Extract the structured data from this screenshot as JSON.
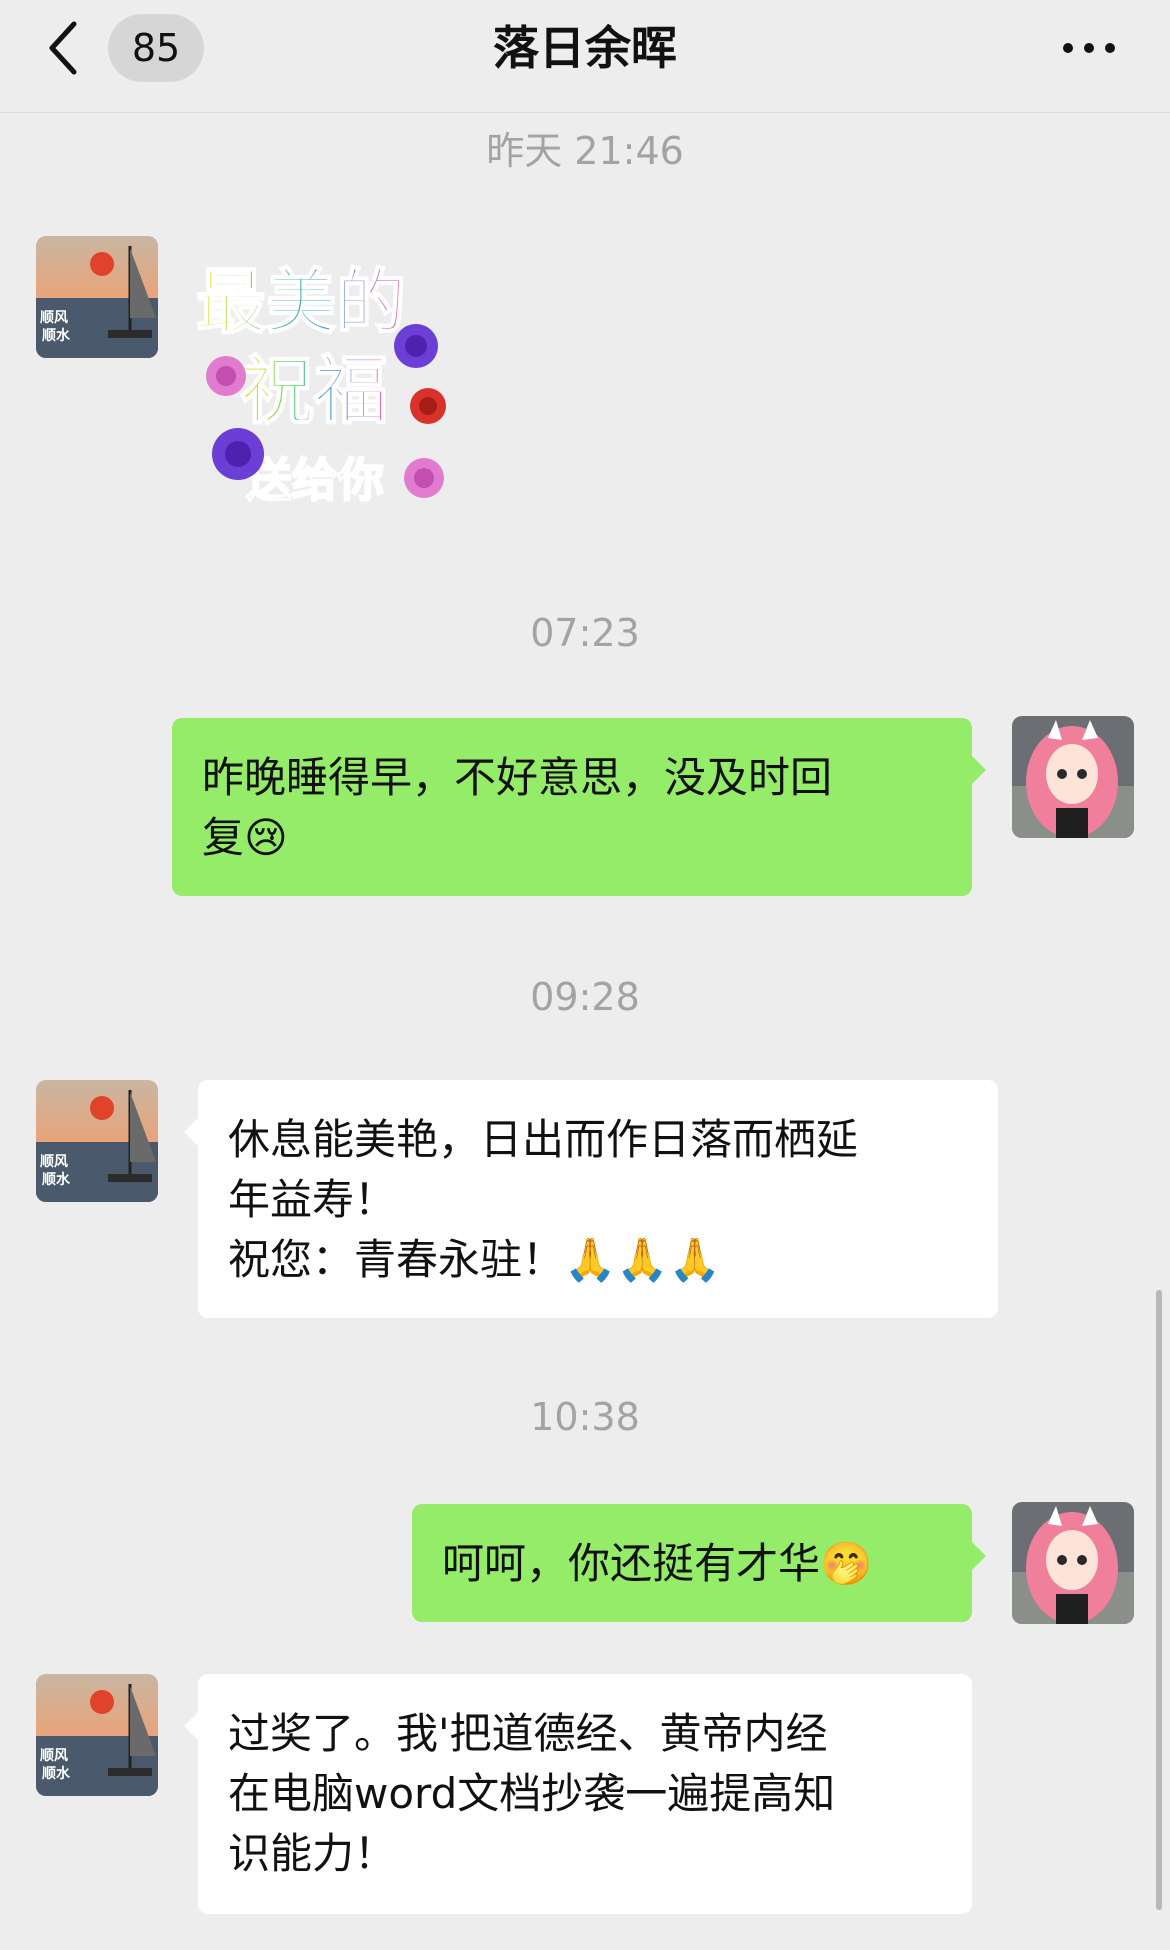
{
  "header": {
    "title": "落日余晖",
    "unread_count": "85",
    "back_icon": "chevron-left-icon",
    "more_icon": "more-dots-icon"
  },
  "messages": [
    {
      "type": "time",
      "text": "昨天 21:46"
    },
    {
      "type": "sticker",
      "from": "contact",
      "lines": [
        "最美的",
        "祝福",
        "送给你"
      ]
    },
    {
      "type": "time",
      "text": "07:23"
    },
    {
      "type": "text",
      "from": "me",
      "lines": [
        "昨晚睡得早，不好意思，没及时回",
        "复😢"
      ]
    },
    {
      "type": "time",
      "text": "09:28"
    },
    {
      "type": "text",
      "from": "contact",
      "lines": [
        "休息能美艳，日出而作日落而栖延",
        "年益寿！",
        "祝您：青春永驻！🙏🙏🙏"
      ]
    },
    {
      "type": "time",
      "text": "10:38"
    },
    {
      "type": "text",
      "from": "me",
      "lines": [
        "呵呵，你还挺有才华🤭"
      ]
    },
    {
      "type": "text",
      "from": "contact",
      "lines": [
        "过奖了。我'把道德经、黄帝内经",
        "在电脑word文档抄袭一遍提高知",
        "识能力！"
      ]
    }
  ],
  "avatars": {
    "contact": {
      "text": "顺风顺水",
      "icon": "sunset-sailboat-avatar"
    },
    "me": {
      "icon": "anime-girl-avatar"
    }
  },
  "colors": {
    "background": "#ededed",
    "outgoing_bubble": "#95ec69",
    "incoming_bubble": "#ffffff",
    "timestamp": "#a3a3a3"
  }
}
